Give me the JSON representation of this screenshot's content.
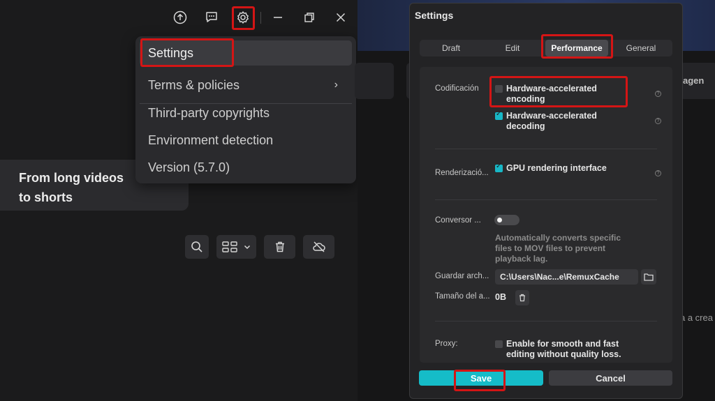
{
  "left": {
    "menu": {
      "items": [
        {
          "label": "Settings"
        },
        {
          "label": "Terms & policies"
        },
        {
          "label": "Third-party copyrights"
        },
        {
          "label": "Environment detection"
        },
        {
          "label": "Version (5.7.0)"
        }
      ]
    },
    "promo": {
      "text": "From long videos to shorts"
    }
  },
  "right_bg": {
    "card_text": "agen",
    "edge_text": "a a crea"
  },
  "settings": {
    "title": "Settings",
    "tabs": [
      {
        "label": "Draft"
      },
      {
        "label": "Edit"
      },
      {
        "label": "Performance"
      },
      {
        "label": "General"
      }
    ],
    "encoding": {
      "label": "Codificación",
      "hw_encoding": "Hardware-accelerated encoding",
      "hw_decoding": "Hardware-accelerated decoding"
    },
    "rendering": {
      "label": "Renderizació...",
      "gpu": "GPU rendering interface"
    },
    "converter": {
      "label": "Conversor ...",
      "desc": "Automatically converts specific files to MOV files to prevent playback lag."
    },
    "cache": {
      "label": "Guardar arch...",
      "path": "C:\\Users\\Nac...e\\RemuxCache"
    },
    "size": {
      "label": "Tamaño del a...",
      "value": "0B"
    },
    "proxy": {
      "label": "Proxy:",
      "text": "Enable for smooth and fast editing without quality loss."
    },
    "buttons": {
      "save": "Save",
      "cancel": "Cancel"
    }
  }
}
